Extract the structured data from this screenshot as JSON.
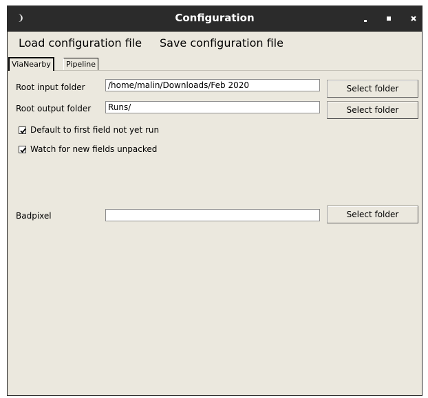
{
  "window": {
    "title": "Configuration"
  },
  "menu": {
    "load": "Load configuration file",
    "save": "Save configuration file"
  },
  "tabs": [
    {
      "label": "ViaNearby"
    },
    {
      "label": "Pipeline"
    }
  ],
  "form": {
    "root_input": {
      "label": "Root input folder",
      "value": "/home/malin/Downloads/Feb 2020",
      "button": "Select folder"
    },
    "root_output": {
      "label": "Root output folder",
      "value": "Runs/",
      "button": "Select folder"
    },
    "default_first": {
      "label": "Default to first field not yet run",
      "checked": true
    },
    "watch_new": {
      "label": "Watch for new fields unpacked",
      "checked": true
    },
    "badpixel": {
      "label": "Badpixel",
      "value": "",
      "button": "Select folder"
    }
  },
  "icons": {
    "window": "app-icon",
    "min": "minimize-icon",
    "max": "maximize-icon",
    "close": "close-icon",
    "check": "checkmark-icon"
  }
}
